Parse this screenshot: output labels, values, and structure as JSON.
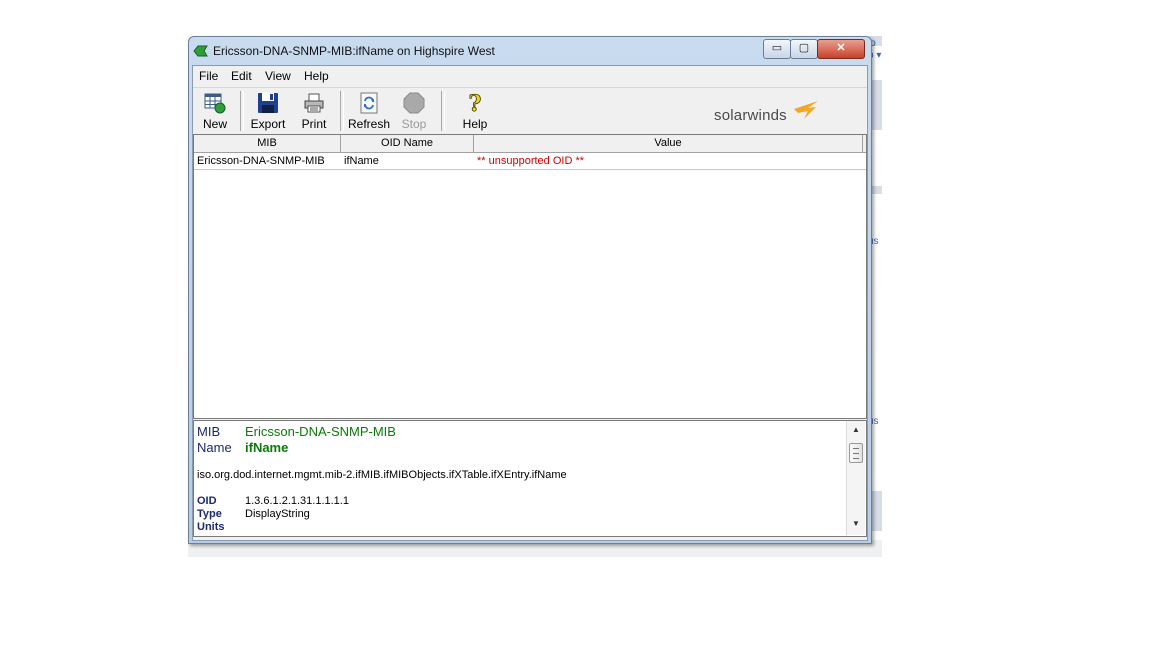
{
  "window": {
    "title": "Ericsson-DNA-SNMP-MIB:ifName on Highspire West",
    "minimize_glyph": "▭",
    "maximize_glyph": "▢",
    "close_glyph": "✕"
  },
  "menu": {
    "items": [
      {
        "label": "File"
      },
      {
        "label": "Edit"
      },
      {
        "label": "View"
      },
      {
        "label": "Help"
      }
    ]
  },
  "toolbar": {
    "buttons": [
      {
        "label": "New",
        "icon": "new-table-icon",
        "enabled": true
      },
      {
        "label": "Export",
        "icon": "floppy-disk-icon",
        "enabled": true
      },
      {
        "label": "Print",
        "icon": "printer-icon",
        "enabled": true
      },
      {
        "label": "Refresh",
        "icon": "refresh-icon",
        "enabled": true
      },
      {
        "label": "Stop",
        "icon": "stop-octagon-icon",
        "enabled": false
      },
      {
        "label": "Help",
        "icon": "question-mark-icon",
        "enabled": true
      }
    ],
    "logo_text": "solarwinds"
  },
  "grid": {
    "columns": [
      "MIB",
      "OID Name",
      "Value"
    ],
    "rows": [
      {
        "mib": "Ericsson-DNA-SNMP-MIB",
        "oid_name": "ifName",
        "value": "** unsupported OID **"
      }
    ]
  },
  "detail": {
    "mib_label": "MIB",
    "mib_value": "Ericsson-DNA-SNMP-MIB",
    "name_label": "Name",
    "name_value": "ifName",
    "path": "iso.org.dod.internet.mgmt.mib-2.ifMIB.ifMIBObjects.ifXTable.ifXEntry.ifName",
    "oid_label": "OID",
    "oid_value": "1.3.6.1.2.1.31.1.1.1.1",
    "type_label": "Type",
    "type_value": "DisplayString",
    "units_label": "Units"
  },
  "background_window": {
    "fragments": [
      "lo",
      "p ▾",
      "us",
      "us"
    ]
  },
  "colors": {
    "error_text": "#d10000",
    "detail_label": "#1a2a6e",
    "detail_value": "#0a7a0a",
    "logo_flame": "#f5a623"
  }
}
